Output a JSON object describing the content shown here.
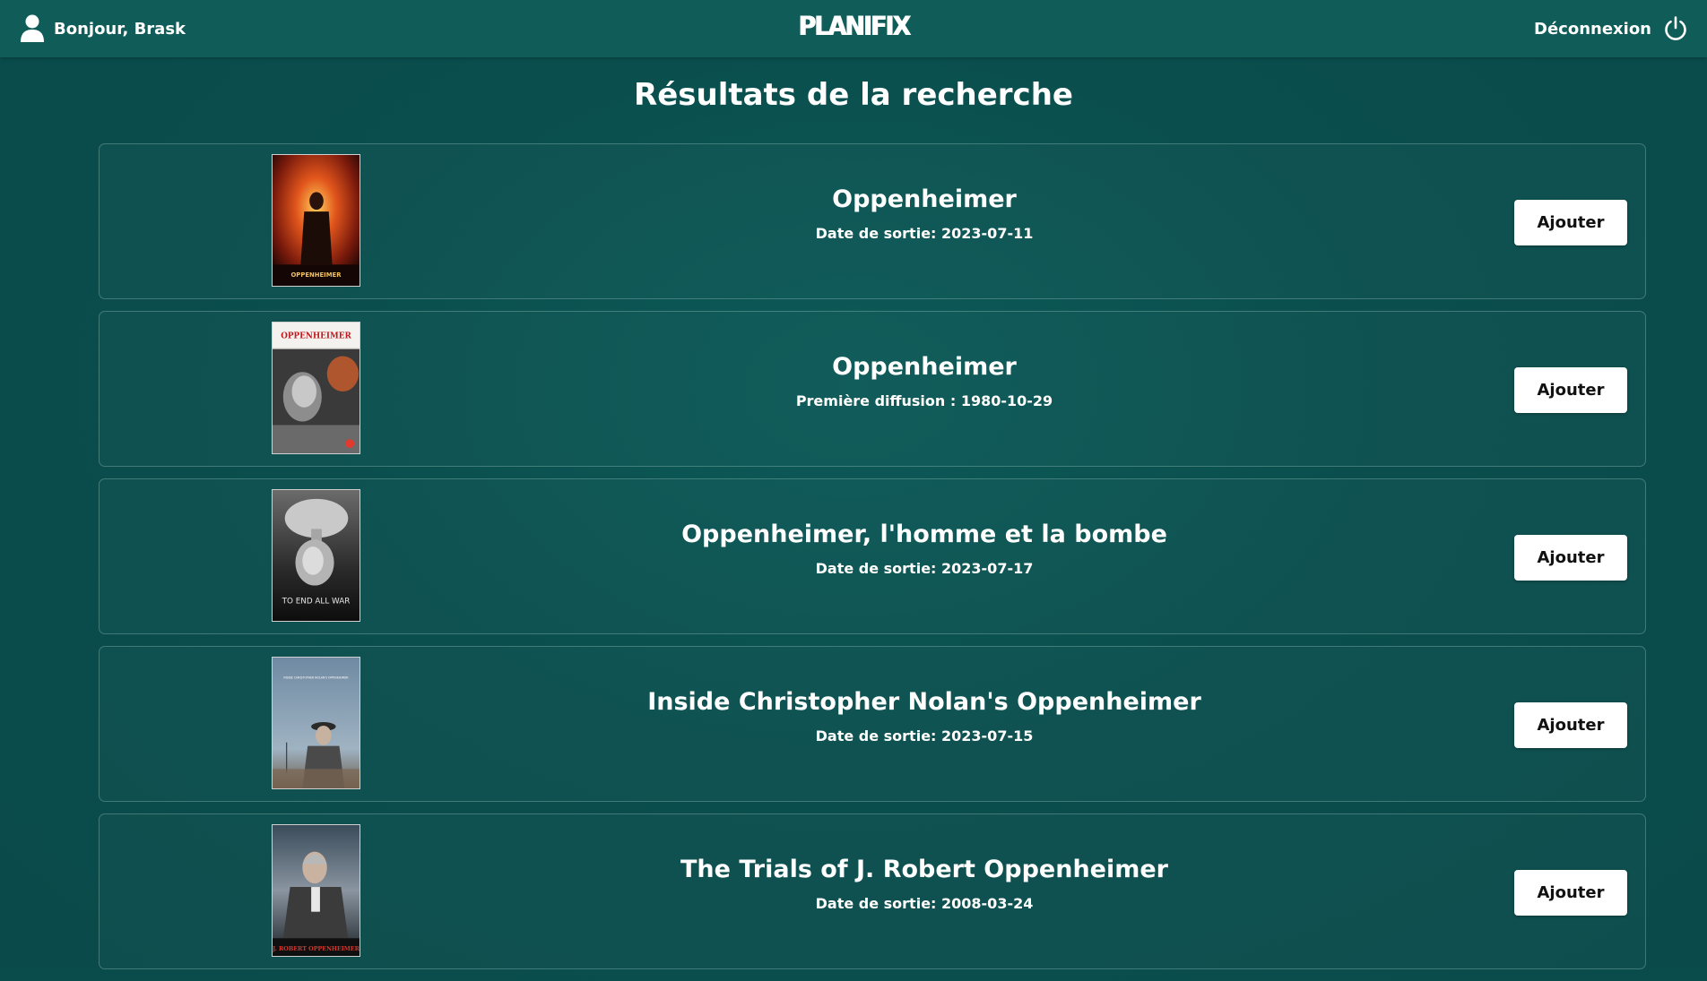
{
  "header": {
    "greeting": "Bonjour, Brask",
    "logo": "PLANIFIX",
    "logout_label": "Déconnexion"
  },
  "page": {
    "title": "Résultats de la recherche"
  },
  "results": [
    {
      "title": "Oppenheimer",
      "date_line": "Date de sortie: 2023-07-11",
      "button_label": "Ajouter",
      "poster_caption": "OPPENHEIMER"
    },
    {
      "title": "Oppenheimer",
      "date_line": "Première diffusion : 1980-10-29",
      "button_label": "Ajouter",
      "poster_caption": "OPPENHEIMER"
    },
    {
      "title": "Oppenheimer, l'homme et la bombe",
      "date_line": "Date de sortie: 2023-07-17",
      "button_label": "Ajouter",
      "poster_caption": "TO END ALL WAR"
    },
    {
      "title": "Inside Christopher Nolan's Oppenheimer",
      "date_line": "Date de sortie: 2023-07-15",
      "button_label": "Ajouter",
      "poster_caption": "INSIDE CHRISTOPHER NOLAN'S OPPENHEIMER"
    },
    {
      "title": "The Trials of J. Robert Oppenheimer",
      "date_line": "Date de sortie: 2008-03-24",
      "button_label": "Ajouter",
      "poster_caption": "J. ROBERT OPPENHEIMER"
    }
  ],
  "colors": {
    "header_bg": "#105c59",
    "page_bg": "#0a4e4d",
    "button_bg": "#ffffff",
    "text": "#ffffff"
  }
}
